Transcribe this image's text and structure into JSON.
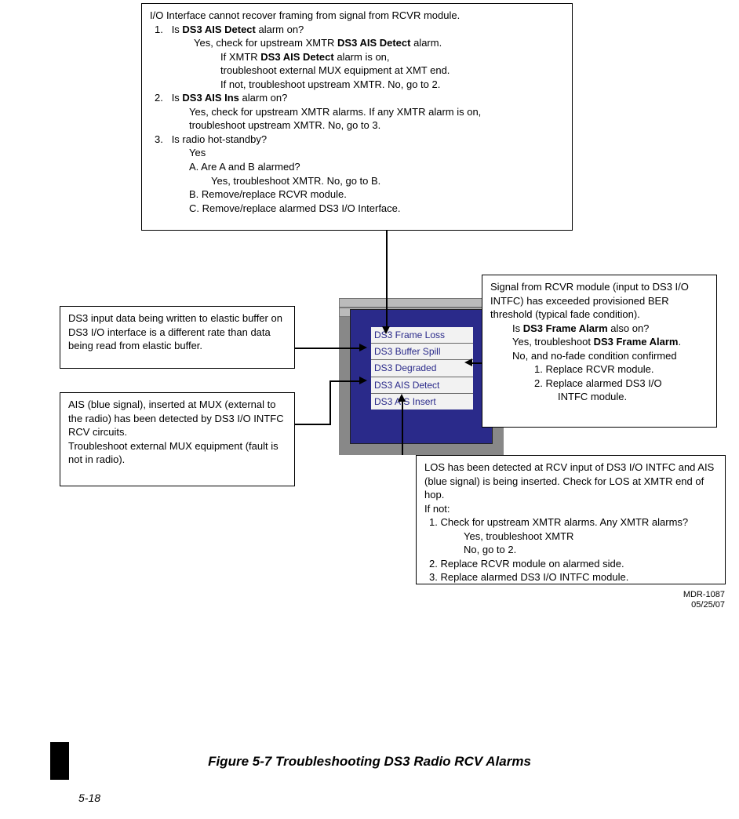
{
  "top_box": {
    "line1": "I/O Interface cannot recover framing from signal from RCVR module.",
    "item1_num": "1.",
    "item1_q": "Is ",
    "item1_bold": "DS3 AIS Detect",
    "item1_q_after": " alarm on?",
    "item1_yes_pre": "Yes, check for upstream XMTR ",
    "item1_yes_bold": "DS3 AIS Detect",
    "item1_yes_post": " alarm.",
    "item1_if_pre": "If XMTR ",
    "item1_if_bold": "DS3 AIS Detect",
    "item1_if_post": " alarm is on,",
    "item1_then": "troubleshoot external MUX equipment at XMT end.",
    "item1_else": "If not, troubleshoot upstream XMTR. No, go to 2.",
    "item2_num": "2.",
    "item2_q_pre": "Is ",
    "item2_q_bold": "DS3 AIS Ins",
    "item2_q_post": " alarm on?",
    "item2_yes": "Yes, check for upstream XMTR alarms. If any XMTR alarm is on,",
    "item2_yes2": "troubleshoot upstream XMTR. No, go to 3.",
    "item3_num": "3.",
    "item3_q": "Is radio hot-standby?",
    "item3_yes": "Yes",
    "item3_a": "A.   Are A and B alarmed?",
    "item3_a2": "Yes, troubleshoot XMTR. No, go to B.",
    "item3_b": "B.   Remove/replace RCVR module.",
    "item3_c": "C.   Remove/replace alarmed DS3 I/O Interface."
  },
  "left1": {
    "text": "DS3 input data being written to elastic buffer on DS3 I/O interface is a different rate than data being read from elastic buffer."
  },
  "left2": {
    "l1": "AIS (blue signal), inserted at MUX (external to the radio) has been detected by DS3 I/O INTFC RCV circuits.",
    "l2": "Troubleshoot external MUX equipment (fault is not in radio)."
  },
  "right1": {
    "l1": "Signal from RCVR module (input to DS3 I/O INTFC) has exceeded provisioned BER threshold (typical fade condition).",
    "l2_pre": "Is ",
    "l2_bold": "DS3 Frame Alarm",
    "l2_post": " also on?",
    "l3_pre": "Yes, troubleshoot ",
    "l3_bold": "DS3 Frame Alarm",
    "l3_post": ".",
    "l4": "No, and no-fade condition confirmed",
    "l5": "1.    Replace RCVR module.",
    "l6": "2.    Replace alarmed DS3 I/O",
    "l7": "INTFC module."
  },
  "right2": {
    "l1": "LOS has been detected at RCV input of DS3 I/O INTFC and AIS (blue signal) is being inserted. Check for LOS at XMTR end of hop.",
    "l2": "If not:",
    "l3": "1.    Check for upstream XMTR alarms. Any XMTR alarms?",
    "l3b": "Yes, troubleshoot XMTR",
    "l3c": "No, go to 2.",
    "l4": "2.    Replace RCVR module on alarmed side.",
    "l5": "3.    Replace alarmed DS3 I/O INTFC module."
  },
  "center_list": {
    "r1": "DS3 Frame Loss",
    "r2": "DS3 Buffer Spill",
    "r3": "DS3 Degraded",
    "r4": "DS3 AIS Detect",
    "r5": "DS3 AIS Insert"
  },
  "ref": {
    "l1": "MDR-1087",
    "l2": "05/25/07"
  },
  "caption": "Figure 5-7  Troubleshooting DS3 Radio RCV Alarms",
  "page": "5-18"
}
